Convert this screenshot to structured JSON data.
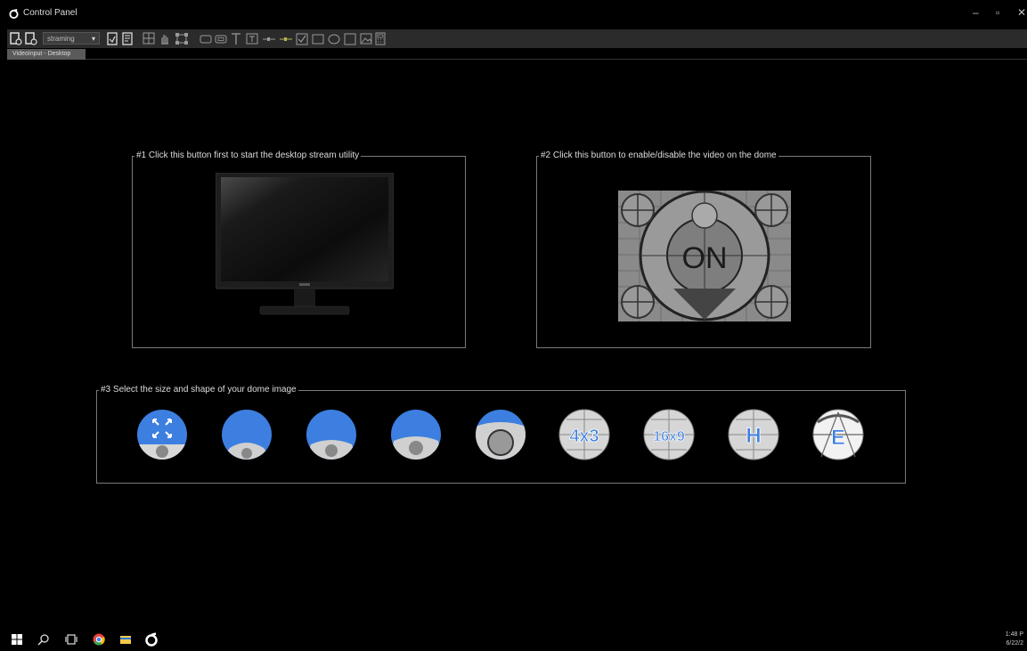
{
  "window": {
    "title": "Control Panel",
    "minimize_glyph": "–",
    "maximize_glyph": "▫",
    "close_glyph": "✕"
  },
  "toolbar": {
    "mode_select": {
      "value": "straming",
      "caret": "▾"
    },
    "icons": [
      "load-layout-icon",
      "save-layout-icon",
      "edit-page-icon",
      "page-settings-icon",
      "grid-icon",
      "hand-pan-icon",
      "select-handles-icon",
      "button-icon",
      "label-box-icon",
      "text-icon",
      "textbox-icon",
      "slider-h-icon",
      "slider-v-icon",
      "checkbox-icon",
      "rectangle-icon",
      "ellipse-icon",
      "square-icon",
      "image-icon",
      "calculator-icon"
    ]
  },
  "tab": {
    "label": "VideoInput - Desktop"
  },
  "groups": {
    "stream": {
      "label": "#1 Click this button first to start the desktop stream utility"
    },
    "dome_video": {
      "label": "#2 Click this button to enable/disable the video on the dome",
      "button_text": "ON"
    },
    "shape": {
      "label": "#3 Select the size and shape of your dome image",
      "buttons": [
        {
          "name": "fullscreen-icon",
          "text": ""
        },
        {
          "name": "dome-fit-1",
          "text": ""
        },
        {
          "name": "dome-fit-2",
          "text": ""
        },
        {
          "name": "dome-fit-3",
          "text": ""
        },
        {
          "name": "dome-fit-4",
          "text": ""
        },
        {
          "name": "aspect-4x3",
          "text": "4x3"
        },
        {
          "name": "aspect-16x9",
          "text": "16x9"
        },
        {
          "name": "mode-h",
          "text": "H"
        },
        {
          "name": "mode-e",
          "text": "E"
        }
      ]
    }
  },
  "colors": {
    "accent_blue": "#3d7fe0",
    "frame": "#7a7a7a",
    "toolbar": "#2b2b2b"
  },
  "taskbar": {
    "icons": [
      "windows-start-icon",
      "search-icon",
      "task-view-icon",
      "chrome-icon",
      "file-explorer-icon",
      "control-panel-app-icon"
    ],
    "clock": {
      "time": "1:48 P",
      "date": "6/22/2"
    }
  }
}
